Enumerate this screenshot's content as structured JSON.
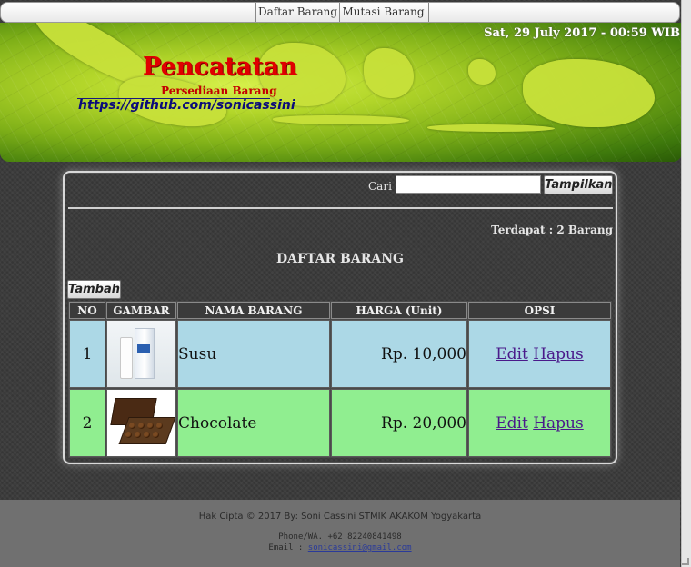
{
  "nav": {
    "items": [
      {
        "label": "Daftar Barang"
      },
      {
        "label": "Mutasi Barang"
      }
    ]
  },
  "header": {
    "datetime": "Sat, 29 July 2017 - 00:59 WIB",
    "title": "Pencatatan",
    "subtitle": "Persediaan Barang",
    "url": "https://github.com/sonicassini"
  },
  "search": {
    "label": "Cari :",
    "value": "",
    "button_label": "Tampilkan"
  },
  "summary": {
    "count_text": "Terdapat : 2 Barang"
  },
  "list": {
    "title": "DAFTAR BARANG",
    "add_button_label": "Tambah",
    "columns": [
      "NO",
      "GAMBAR",
      "NAMA BARANG",
      "HARGA (Unit)",
      "OPSI"
    ],
    "rows": [
      {
        "no": "1",
        "image_icon": "milk-image",
        "name": "Susu",
        "price": "Rp. 10,000",
        "edit": "Edit",
        "delete": "Hapus",
        "row_color": "#acd8e6"
      },
      {
        "no": "2",
        "image_icon": "chocolate-image",
        "name": "Chocolate",
        "price": "Rp. 20,000",
        "edit": "Edit",
        "delete": "Hapus",
        "row_color": "#90ee90"
      }
    ]
  },
  "footer": {
    "copyright": "Hak Cipta © 2017 By: Soni Cassini STMIK AKAKOM Yogyakarta",
    "phone": "Phone/WA. +62 82240841498",
    "email_label": "Email :",
    "email": "sonicassini@gmail.com"
  },
  "colors": {
    "brand_red": "#e00000",
    "row_blue": "#acd8e6",
    "row_green": "#90ee90"
  }
}
